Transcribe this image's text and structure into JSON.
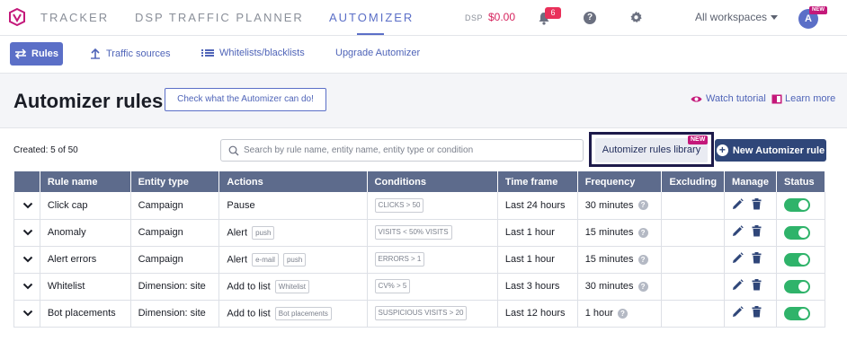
{
  "header": {
    "nav": [
      "TRACKER",
      "DSP TRAFFIC PLANNER",
      "AUTOMIZER"
    ],
    "dsp_label": "DSP",
    "dsp_value": "$0.00",
    "notifications": "6",
    "workspaces": "All workspaces",
    "avatar": "A",
    "avatar_badge": "NEW"
  },
  "subnav": {
    "rules": "Rules",
    "traffic_sources": "Traffic sources",
    "whitelists": "Whitelists/blacklists",
    "upgrade": "Upgrade Automizer"
  },
  "page": {
    "title": "Automizer rules",
    "check_button": "Check what the Automizer can do!",
    "watch_tutorial": "Watch tutorial",
    "learn_more": "Learn more",
    "created": "Created: 5 of 50",
    "search_placeholder": "Search by rule name, entity name, entity type or condition",
    "library_button": "Automizer rules library",
    "library_badge": "NEW",
    "new_rule_button": "New Automizer rule"
  },
  "table": {
    "columns": [
      "Rule name",
      "Entity type",
      "Actions",
      "Conditions",
      "Time frame",
      "Frequency",
      "Excluding",
      "Manage",
      "Status"
    ],
    "rows": [
      {
        "name": "Click cap",
        "entity": "Campaign",
        "action": "Pause",
        "tags": [],
        "condition": "CLICKS > 50",
        "timeframe": "Last 24 hours",
        "frequency": "30 minutes",
        "excluding": ""
      },
      {
        "name": "Anomaly",
        "entity": "Campaign",
        "action": "Alert",
        "tags": [
          "push"
        ],
        "condition": "VISITS < 50% VISITS",
        "timeframe": "Last 1 hour",
        "frequency": "15 minutes",
        "excluding": ""
      },
      {
        "name": "Alert errors",
        "entity": "Campaign",
        "action": "Alert",
        "tags": [
          "e-mail",
          "push"
        ],
        "condition": "ERRORS > 1",
        "timeframe": "Last 1 hour",
        "frequency": "15 minutes",
        "excluding": ""
      },
      {
        "name": "Whitelist",
        "entity": "Dimension: site",
        "action": "Add to list",
        "tags": [
          "Whitelist"
        ],
        "condition": "CV% > 5",
        "timeframe": "Last 3 hours",
        "frequency": "30 minutes",
        "excluding": ""
      },
      {
        "name": "Bot placements",
        "entity": "Dimension: site",
        "action": "Add to list",
        "tags": [
          "Bot placements"
        ],
        "condition": "SUSPICIOUS VISITS > 20",
        "timeframe": "Last 12 hours",
        "frequency": "1 hour",
        "excluding": ""
      }
    ]
  },
  "colors": {
    "accent": "#5b6fc7",
    "header_row": "#5d6b8c",
    "primary_button": "#2f4679",
    "toggle_on": "#2fb36a",
    "badge": "#c4187a"
  }
}
